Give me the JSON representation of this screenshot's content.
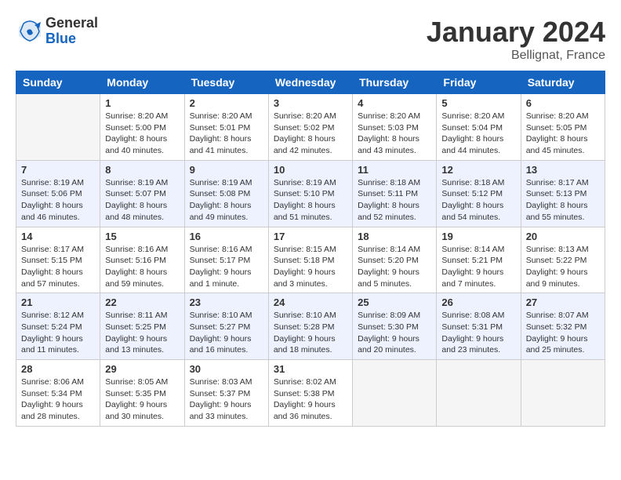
{
  "header": {
    "logo_general": "General",
    "logo_blue": "Blue",
    "month_title": "January 2024",
    "location": "Bellignat, France"
  },
  "columns": [
    "Sunday",
    "Monday",
    "Tuesday",
    "Wednesday",
    "Thursday",
    "Friday",
    "Saturday"
  ],
  "weeks": [
    [
      {
        "day": "",
        "info": ""
      },
      {
        "day": "1",
        "info": "Sunrise: 8:20 AM\nSunset: 5:00 PM\nDaylight: 8 hours\nand 40 minutes."
      },
      {
        "day": "2",
        "info": "Sunrise: 8:20 AM\nSunset: 5:01 PM\nDaylight: 8 hours\nand 41 minutes."
      },
      {
        "day": "3",
        "info": "Sunrise: 8:20 AM\nSunset: 5:02 PM\nDaylight: 8 hours\nand 42 minutes."
      },
      {
        "day": "4",
        "info": "Sunrise: 8:20 AM\nSunset: 5:03 PM\nDaylight: 8 hours\nand 43 minutes."
      },
      {
        "day": "5",
        "info": "Sunrise: 8:20 AM\nSunset: 5:04 PM\nDaylight: 8 hours\nand 44 minutes."
      },
      {
        "day": "6",
        "info": "Sunrise: 8:20 AM\nSunset: 5:05 PM\nDaylight: 8 hours\nand 45 minutes."
      }
    ],
    [
      {
        "day": "7",
        "info": "Sunrise: 8:19 AM\nSunset: 5:06 PM\nDaylight: 8 hours\nand 46 minutes."
      },
      {
        "day": "8",
        "info": "Sunrise: 8:19 AM\nSunset: 5:07 PM\nDaylight: 8 hours\nand 48 minutes."
      },
      {
        "day": "9",
        "info": "Sunrise: 8:19 AM\nSunset: 5:08 PM\nDaylight: 8 hours\nand 49 minutes."
      },
      {
        "day": "10",
        "info": "Sunrise: 8:19 AM\nSunset: 5:10 PM\nDaylight: 8 hours\nand 51 minutes."
      },
      {
        "day": "11",
        "info": "Sunrise: 8:18 AM\nSunset: 5:11 PM\nDaylight: 8 hours\nand 52 minutes."
      },
      {
        "day": "12",
        "info": "Sunrise: 8:18 AM\nSunset: 5:12 PM\nDaylight: 8 hours\nand 54 minutes."
      },
      {
        "day": "13",
        "info": "Sunrise: 8:17 AM\nSunset: 5:13 PM\nDaylight: 8 hours\nand 55 minutes."
      }
    ],
    [
      {
        "day": "14",
        "info": "Sunrise: 8:17 AM\nSunset: 5:15 PM\nDaylight: 8 hours\nand 57 minutes."
      },
      {
        "day": "15",
        "info": "Sunrise: 8:16 AM\nSunset: 5:16 PM\nDaylight: 8 hours\nand 59 minutes."
      },
      {
        "day": "16",
        "info": "Sunrise: 8:16 AM\nSunset: 5:17 PM\nDaylight: 9 hours\nand 1 minute."
      },
      {
        "day": "17",
        "info": "Sunrise: 8:15 AM\nSunset: 5:18 PM\nDaylight: 9 hours\nand 3 minutes."
      },
      {
        "day": "18",
        "info": "Sunrise: 8:14 AM\nSunset: 5:20 PM\nDaylight: 9 hours\nand 5 minutes."
      },
      {
        "day": "19",
        "info": "Sunrise: 8:14 AM\nSunset: 5:21 PM\nDaylight: 9 hours\nand 7 minutes."
      },
      {
        "day": "20",
        "info": "Sunrise: 8:13 AM\nSunset: 5:22 PM\nDaylight: 9 hours\nand 9 minutes."
      }
    ],
    [
      {
        "day": "21",
        "info": "Sunrise: 8:12 AM\nSunset: 5:24 PM\nDaylight: 9 hours\nand 11 minutes."
      },
      {
        "day": "22",
        "info": "Sunrise: 8:11 AM\nSunset: 5:25 PM\nDaylight: 9 hours\nand 13 minutes."
      },
      {
        "day": "23",
        "info": "Sunrise: 8:10 AM\nSunset: 5:27 PM\nDaylight: 9 hours\nand 16 minutes."
      },
      {
        "day": "24",
        "info": "Sunrise: 8:10 AM\nSunset: 5:28 PM\nDaylight: 9 hours\nand 18 minutes."
      },
      {
        "day": "25",
        "info": "Sunrise: 8:09 AM\nSunset: 5:30 PM\nDaylight: 9 hours\nand 20 minutes."
      },
      {
        "day": "26",
        "info": "Sunrise: 8:08 AM\nSunset: 5:31 PM\nDaylight: 9 hours\nand 23 minutes."
      },
      {
        "day": "27",
        "info": "Sunrise: 8:07 AM\nSunset: 5:32 PM\nDaylight: 9 hours\nand 25 minutes."
      }
    ],
    [
      {
        "day": "28",
        "info": "Sunrise: 8:06 AM\nSunset: 5:34 PM\nDaylight: 9 hours\nand 28 minutes."
      },
      {
        "day": "29",
        "info": "Sunrise: 8:05 AM\nSunset: 5:35 PM\nDaylight: 9 hours\nand 30 minutes."
      },
      {
        "day": "30",
        "info": "Sunrise: 8:03 AM\nSunset: 5:37 PM\nDaylight: 9 hours\nand 33 minutes."
      },
      {
        "day": "31",
        "info": "Sunrise: 8:02 AM\nSunset: 5:38 PM\nDaylight: 9 hours\nand 36 minutes."
      },
      {
        "day": "",
        "info": ""
      },
      {
        "day": "",
        "info": ""
      },
      {
        "day": "",
        "info": ""
      }
    ]
  ]
}
